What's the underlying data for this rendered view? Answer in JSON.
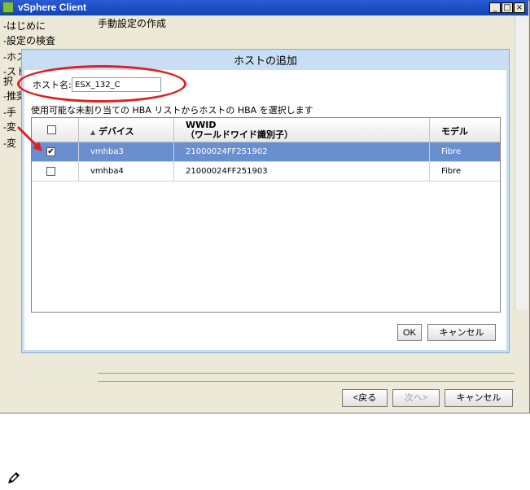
{
  "window": {
    "title": "vSphere Client",
    "buttons": [
      "_",
      "□",
      "×"
    ]
  },
  "nav": {
    "items": [
      "-はじめに",
      "-設定の検査",
      "-ホス",
      "-スト",
      "択",
      "-推奨",
      "-手",
      "-変",
      "-変"
    ]
  },
  "wizard": {
    "title": "手動設定の作成",
    "back_label": "<戻る",
    "next_label": "次へ>",
    "cancel_label": "キャンセル"
  },
  "dialog": {
    "title": "ホストの追加",
    "hostname_label": "ホスト名:",
    "hostname_value": "ESX_132_C",
    "instruction": "使用可能な未割り当ての HBA リストからホストの HBA を選択します",
    "columns": {
      "device": "デバイス",
      "wwid_line1": "WWID",
      "wwid_line2": "（ワールドワイド識別子）",
      "model": "モデル"
    },
    "sort_indicator": "▲",
    "rows": [
      {
        "checked": true,
        "device": "vmhba3",
        "wwid": "21000024FF251902",
        "model": "Fibre"
      },
      {
        "checked": false,
        "device": "vmhba4",
        "wwid": "21000024FF251903",
        "model": "Fibre"
      }
    ],
    "ok_label": "OK",
    "cancel_label": "キャンセル"
  },
  "colors": {
    "titlebar": "#1a4fc4",
    "selected_row": "#6a8fd0",
    "annotation": "#e02020"
  },
  "icons": {
    "note": "note-pencil-icon"
  }
}
